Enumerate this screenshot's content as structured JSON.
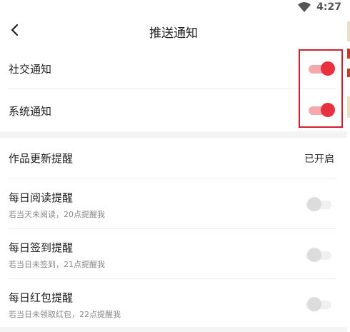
{
  "status_bar": {
    "time": "4:27",
    "wifi_icon": "wifi-icon"
  },
  "header": {
    "title": "推送通知",
    "back_icon": "chevron-left-icon"
  },
  "notifications": [
    {
      "label": "社交通知",
      "enabled": true
    },
    {
      "label": "系统通知",
      "enabled": true
    }
  ],
  "works_update": {
    "label": "作品更新提醒",
    "status": "已开启"
  },
  "reminders": [
    {
      "label": "每日阅读提醒",
      "description": "若当天未阅读，20点提醒我",
      "enabled": false
    },
    {
      "label": "每日签到提醒",
      "description": "若当日未签到，21点提醒我",
      "enabled": false
    },
    {
      "label": "每日红包提醒",
      "description": "若当日未领取红包，22点提醒我",
      "enabled": false
    }
  ],
  "colors": {
    "accent": "#e8313f",
    "accent_track": "#f5a9ad",
    "highlight_border": "#d21f2c",
    "background": "#f4f4f4"
  }
}
